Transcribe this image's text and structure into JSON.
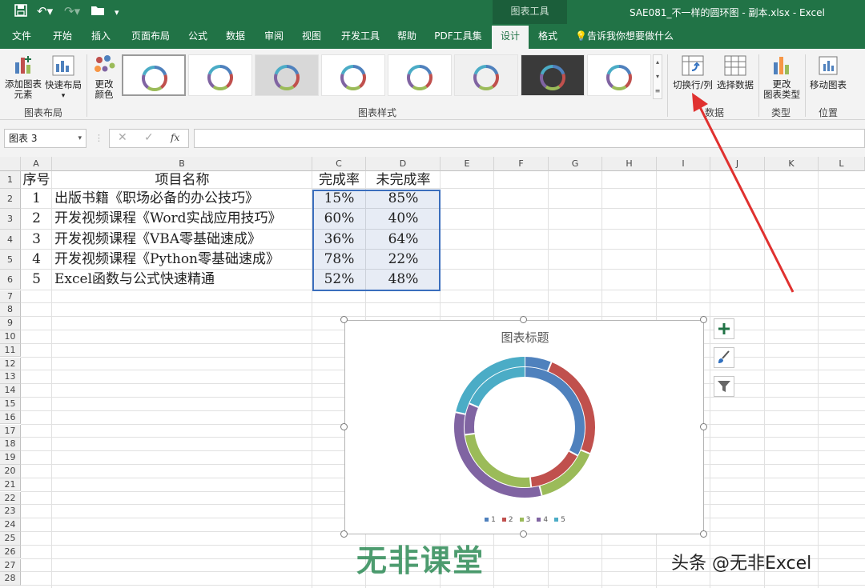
{
  "titlebar": {
    "context_tools": "图表工具",
    "doc_title": "SAE081_不一样的圆环图 - 副本.xlsx  -  Excel"
  },
  "tabs": [
    "文件",
    "开始",
    "插入",
    "页面布局",
    "公式",
    "数据",
    "审阅",
    "视图",
    "开发工具",
    "帮助",
    "PDF工具集",
    "设计",
    "格式"
  ],
  "active_tab": "设计",
  "tell_me": "告诉我你想要做什么",
  "ribbon": {
    "add_chart_element": "添加图表\n元素",
    "quick_layout": "快速布局",
    "change_colors": "更改\n颜色",
    "switch_row_col": "切换行/列",
    "select_data": "选择数据",
    "change_chart_type": "更改\n图表类型",
    "move_chart": "移动图表",
    "groups": {
      "layout": "图表布局",
      "styles": "图表样式",
      "data": "数据",
      "type": "类型",
      "location": "位置"
    }
  },
  "namebox": "图表 3",
  "columns": [
    "A",
    "B",
    "C",
    "D",
    "E",
    "F",
    "G",
    "H",
    "I",
    "J",
    "K",
    "L"
  ],
  "rows": [
    "1",
    "2",
    "3",
    "4",
    "5",
    "6",
    "7",
    "8",
    "9",
    "10",
    "11",
    "12",
    "13",
    "14",
    "15",
    "16",
    "17",
    "18",
    "19",
    "20",
    "21",
    "22",
    "23",
    "24",
    "25",
    "26",
    "27",
    "28"
  ],
  "table": {
    "headers": [
      "序号",
      "项目名称",
      "完成率",
      "未完成率"
    ],
    "rows": [
      [
        "1",
        "出版书籍《职场必备的办公技巧》",
        "15%",
        "85%"
      ],
      [
        "2",
        "开发视频课程《Word实战应用技巧》",
        "60%",
        "40%"
      ],
      [
        "3",
        "开发视频课程《VBA零基础速成》",
        "36%",
        "64%"
      ],
      [
        "4",
        "开发视频课程《Python零基础速成》",
        "78%",
        "22%"
      ],
      [
        "5",
        "Excel函数与公式快速精通",
        "52%",
        "48%"
      ]
    ]
  },
  "chart_data": {
    "type": "doughnut",
    "title": "图表标题",
    "categories": [
      "1",
      "2",
      "3",
      "4",
      "5"
    ],
    "colors": [
      "#4f81bd",
      "#c0504d",
      "#9bbb59",
      "#8064a2",
      "#4bacc6"
    ],
    "series": [
      {
        "name": "完成率",
        "values": [
          0.15,
          0.6,
          0.36,
          0.78,
          0.52
        ]
      },
      {
        "name": "未完成率",
        "values": [
          0.85,
          0.4,
          0.64,
          0.22,
          0.48
        ]
      }
    ],
    "legend": "bottom"
  },
  "watermark": {
    "logo": "无非课堂",
    "credit": "头条 @无非Excel"
  },
  "colors": {
    "excel_green": "#217346",
    "arrow": "#e0312f"
  }
}
